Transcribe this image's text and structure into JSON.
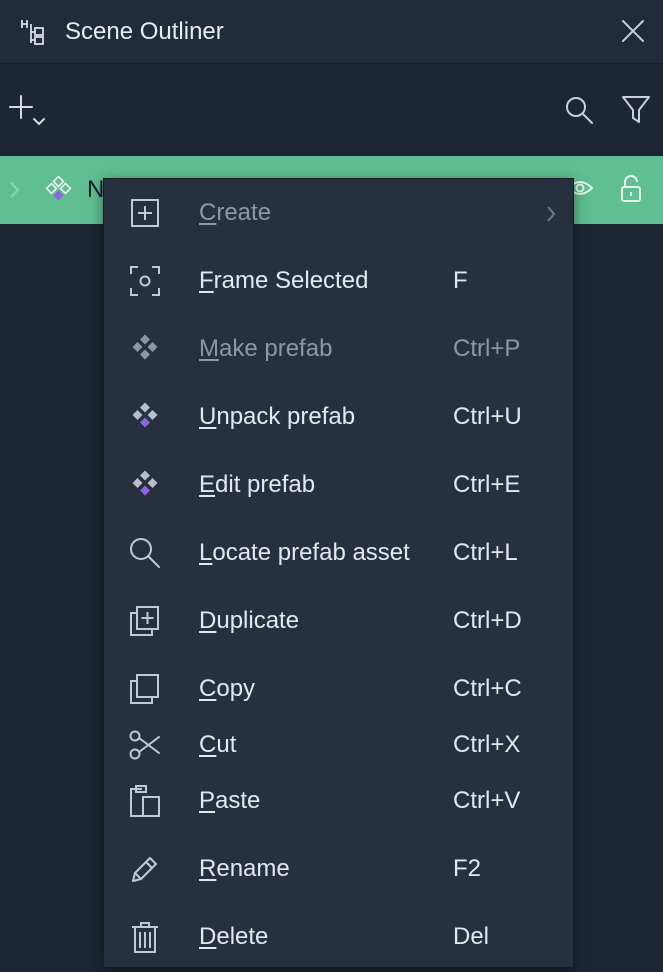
{
  "header": {
    "title": "Scene Outliner"
  },
  "outliner": {
    "row_name": "N"
  },
  "menu": {
    "items": [
      {
        "first": "C",
        "rest": "reate",
        "shortcut": "",
        "icon": "plus-square-icon",
        "disabled": true,
        "submenu": true
      },
      {
        "first": "F",
        "rest": "rame Selected",
        "shortcut": "F",
        "icon": "frame-target-icon",
        "disabled": false
      },
      {
        "first": "M",
        "rest": "ake prefab",
        "shortcut": "Ctrl+P",
        "icon": "prefab-icon",
        "disabled": true
      },
      {
        "first": "U",
        "rest": "npack prefab",
        "shortcut": "Ctrl+U",
        "icon": "prefab-icon",
        "disabled": false
      },
      {
        "first": "E",
        "rest": "dit prefab",
        "shortcut": "Ctrl+E",
        "icon": "prefab-icon",
        "disabled": false
      },
      {
        "first": "L",
        "rest": "ocate prefab asset",
        "shortcut": "Ctrl+L",
        "icon": "search-icon",
        "disabled": false
      },
      {
        "first": "D",
        "rest": "uplicate",
        "shortcut": "Ctrl+D",
        "icon": "duplicate-icon",
        "disabled": false
      },
      {
        "first": "C",
        "rest": "opy",
        "shortcut": "Ctrl+C",
        "icon": "copy-icon",
        "disabled": false
      },
      {
        "first": "C",
        "rest": "ut",
        "shortcut": "Ctrl+X",
        "icon": "scissors-icon",
        "disabled": false
      },
      {
        "first": "P",
        "rest": "aste",
        "shortcut": "Ctrl+V",
        "icon": "paste-icon",
        "disabled": false
      },
      {
        "first": "R",
        "rest": "ename",
        "shortcut": "F2",
        "icon": "pencil-icon",
        "disabled": false
      },
      {
        "first": "D",
        "rest": "elete",
        "shortcut": "Del",
        "icon": "trash-icon",
        "disabled": false
      }
    ]
  },
  "colors": {
    "panel_bg": "#1e2634",
    "header_bg": "#222b3a",
    "selected_row": "#5fbf92",
    "menu_bg": "#27303f",
    "prefab_accent": "#8f63e8"
  }
}
